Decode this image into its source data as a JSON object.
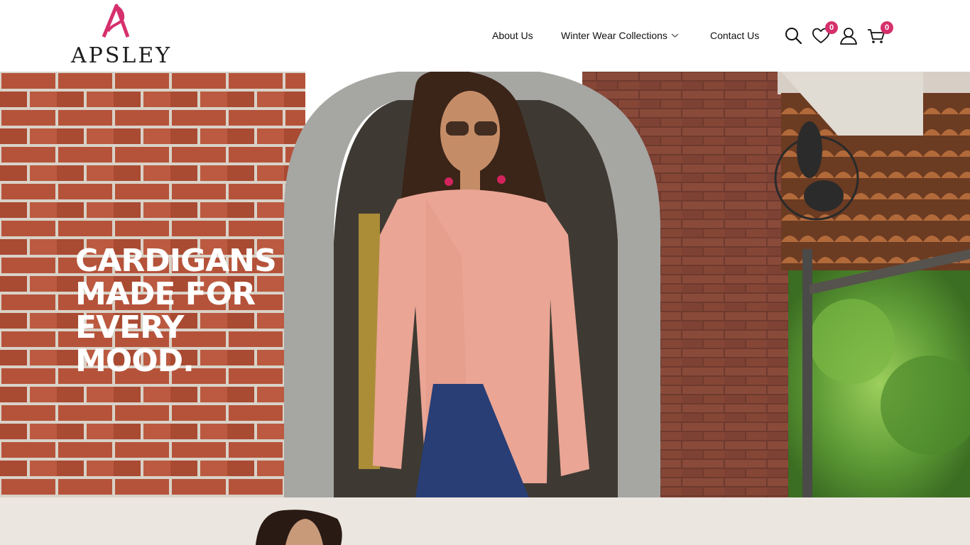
{
  "brand": {
    "name": "APSLEY",
    "accent": "#d6306c"
  },
  "nav": {
    "items": [
      {
        "label": "About Us"
      },
      {
        "label": "Winter Wear Collections",
        "has_dropdown": true
      },
      {
        "label": "Contact Us"
      }
    ]
  },
  "actions": {
    "search_icon": "search-icon",
    "wishlist": {
      "icon": "heart-icon",
      "count": "0"
    },
    "account_icon": "user-icon",
    "cart": {
      "icon": "cart-icon",
      "count": "0"
    }
  },
  "hero": {
    "lines": [
      "CARDIGANS",
      "MADE FOR",
      "EVERY",
      "MOOD."
    ]
  }
}
